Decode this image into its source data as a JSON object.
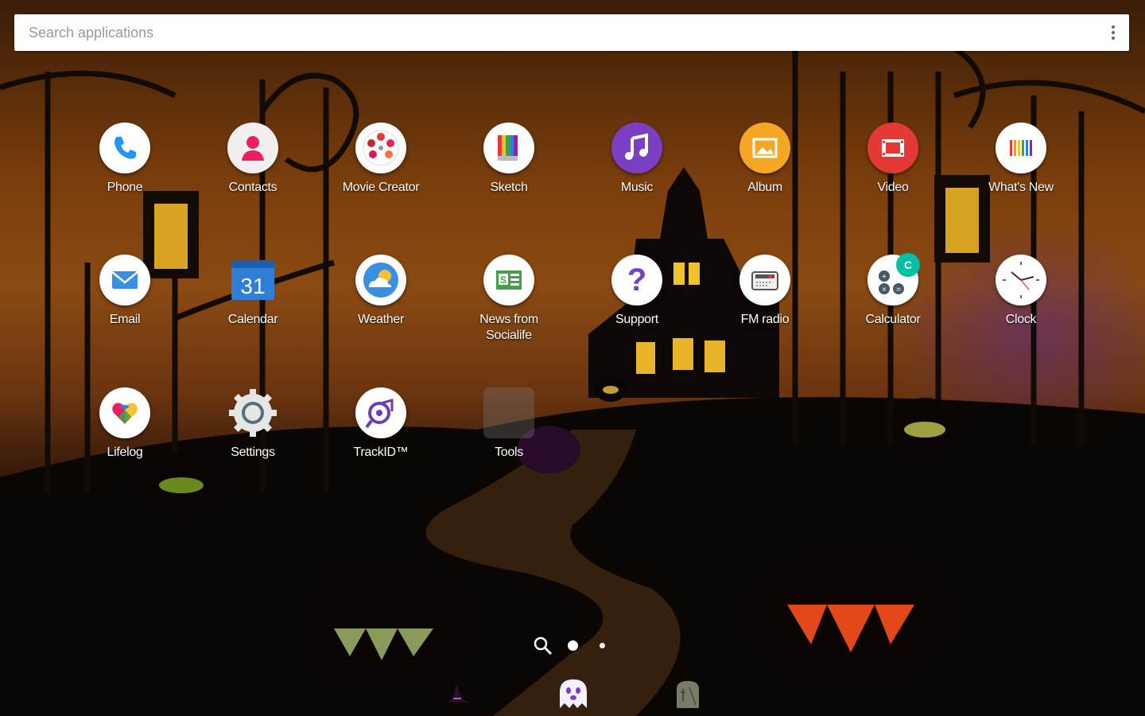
{
  "search": {
    "placeholder": "Search applications"
  },
  "apps": [
    {
      "label": "Phone",
      "icon": "phone-icon"
    },
    {
      "label": "Contacts",
      "icon": "contacts-icon"
    },
    {
      "label": "Movie Creator",
      "icon": "movie-creator-icon"
    },
    {
      "label": "Sketch",
      "icon": "sketch-icon"
    },
    {
      "label": "Music",
      "icon": "music-icon"
    },
    {
      "label": "Album",
      "icon": "album-icon"
    },
    {
      "label": "Video",
      "icon": "video-icon"
    },
    {
      "label": "What's New",
      "icon": "whats-new-icon"
    },
    {
      "label": "Email",
      "icon": "email-icon"
    },
    {
      "label": "Calendar",
      "icon": "calendar-icon",
      "badge": "31"
    },
    {
      "label": "Weather",
      "icon": "weather-icon"
    },
    {
      "label": "News from Socialife",
      "icon": "news-icon"
    },
    {
      "label": "Support",
      "icon": "support-icon",
      "glyph": "?"
    },
    {
      "label": "FM radio",
      "icon": "fm-radio-icon"
    },
    {
      "label": "Calculator",
      "icon": "calculator-icon",
      "badge": "C"
    },
    {
      "label": "Clock",
      "icon": "clock-icon"
    },
    {
      "label": "Lifelog",
      "icon": "lifelog-icon"
    },
    {
      "label": "Settings",
      "icon": "settings-icon"
    },
    {
      "label": "TrackID™",
      "icon": "trackid-icon"
    },
    {
      "label": "Tools",
      "icon": "folder-icon"
    }
  ],
  "pager": {
    "pages": 2,
    "current": 1
  },
  "dock": [
    {
      "icon": "witch-hat-icon"
    },
    {
      "icon": "ghost-icon"
    },
    {
      "icon": "tombstone-icon"
    }
  ],
  "colors": {
    "phone": "#2196f3",
    "contacts": "#e91e63",
    "music": "#7b3fc4",
    "album": "#f5a623",
    "video": "#e53935",
    "calendar": "#2f7fd8",
    "weather": "#3b8fe0",
    "news": "#43a047",
    "calculator": "#455a64",
    "trackid": "#6a3fb5",
    "accent": "#00bfa5"
  }
}
